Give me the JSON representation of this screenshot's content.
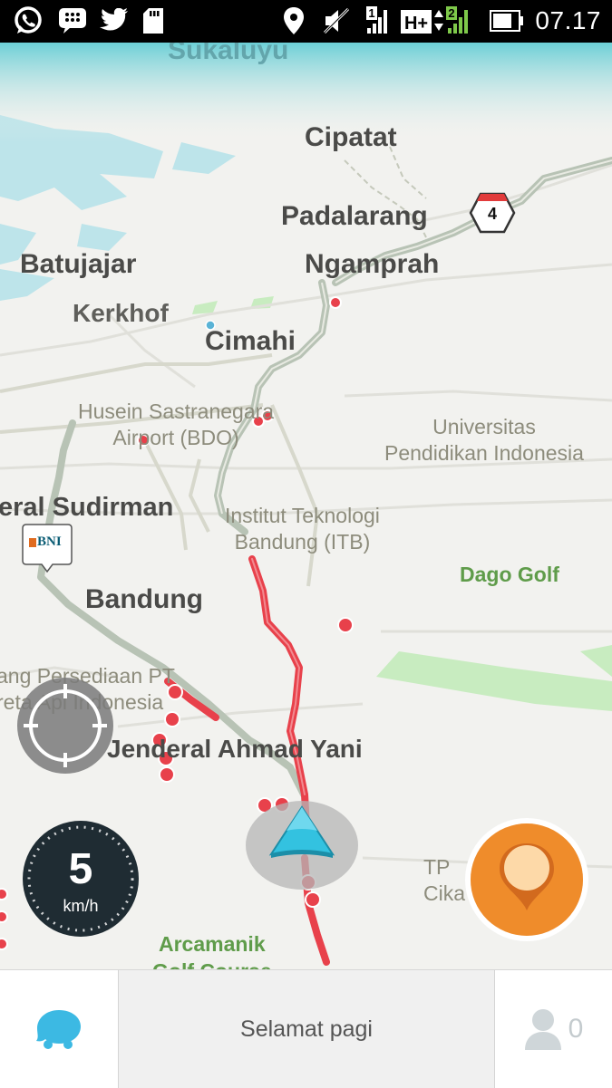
{
  "status_bar": {
    "time": "07.17",
    "network_type": "H+",
    "sim1_label": "1",
    "sim2_label": "2",
    "icons": [
      "whatsapp-icon",
      "bbm-icon",
      "twitter-icon",
      "sd-card-icon",
      "location-icon",
      "no-sound-icon",
      "signal-icon",
      "battery-icon"
    ]
  },
  "map": {
    "labels": {
      "sukaluyu": "Sukaluyu",
      "cipatat": "Cipatat",
      "padalarang": "Padalarang",
      "ngamprah": "Ngamprah",
      "batujajar": "Batujajar",
      "kerkhof": "Kerkhof",
      "cimahi": "Cimahi",
      "airport_line1": "Husein Sastranegara",
      "airport_line2": "Airport (BDO)",
      "upi_line1": "Universitas",
      "upi_line2": "Pendidikan Indonesia",
      "sudirman": "eral Sudirman",
      "itb_line1": "Institut Teknologi",
      "itb_line2": "Bandung (ITB)",
      "dago_golf": "Dago Golf",
      "bandung": "Bandung",
      "kai_line1": "ang Persediaan PT",
      "kai_line2": "reta Api Indonesia",
      "ahmad_yani": "Jenderal Ahmad Yani",
      "tp_line1": "TP",
      "tp_line2": "Cika",
      "arcamanik_line1": "Arcamanik",
      "arcamanik_line2": "Golf Course"
    },
    "highway_shield": "4",
    "bank_marker": "BNI",
    "colors": {
      "traffic_jam": "#e8414b",
      "nav_arrow": "#33c2e0",
      "report_button": "#f39a2c",
      "park": "#c6edc0",
      "water": "#b9e5ea"
    }
  },
  "speedometer": {
    "speed": "5",
    "unit": "km/h"
  },
  "bottom_bar": {
    "greeting": "Selamat pagi",
    "friends_count": "0"
  }
}
